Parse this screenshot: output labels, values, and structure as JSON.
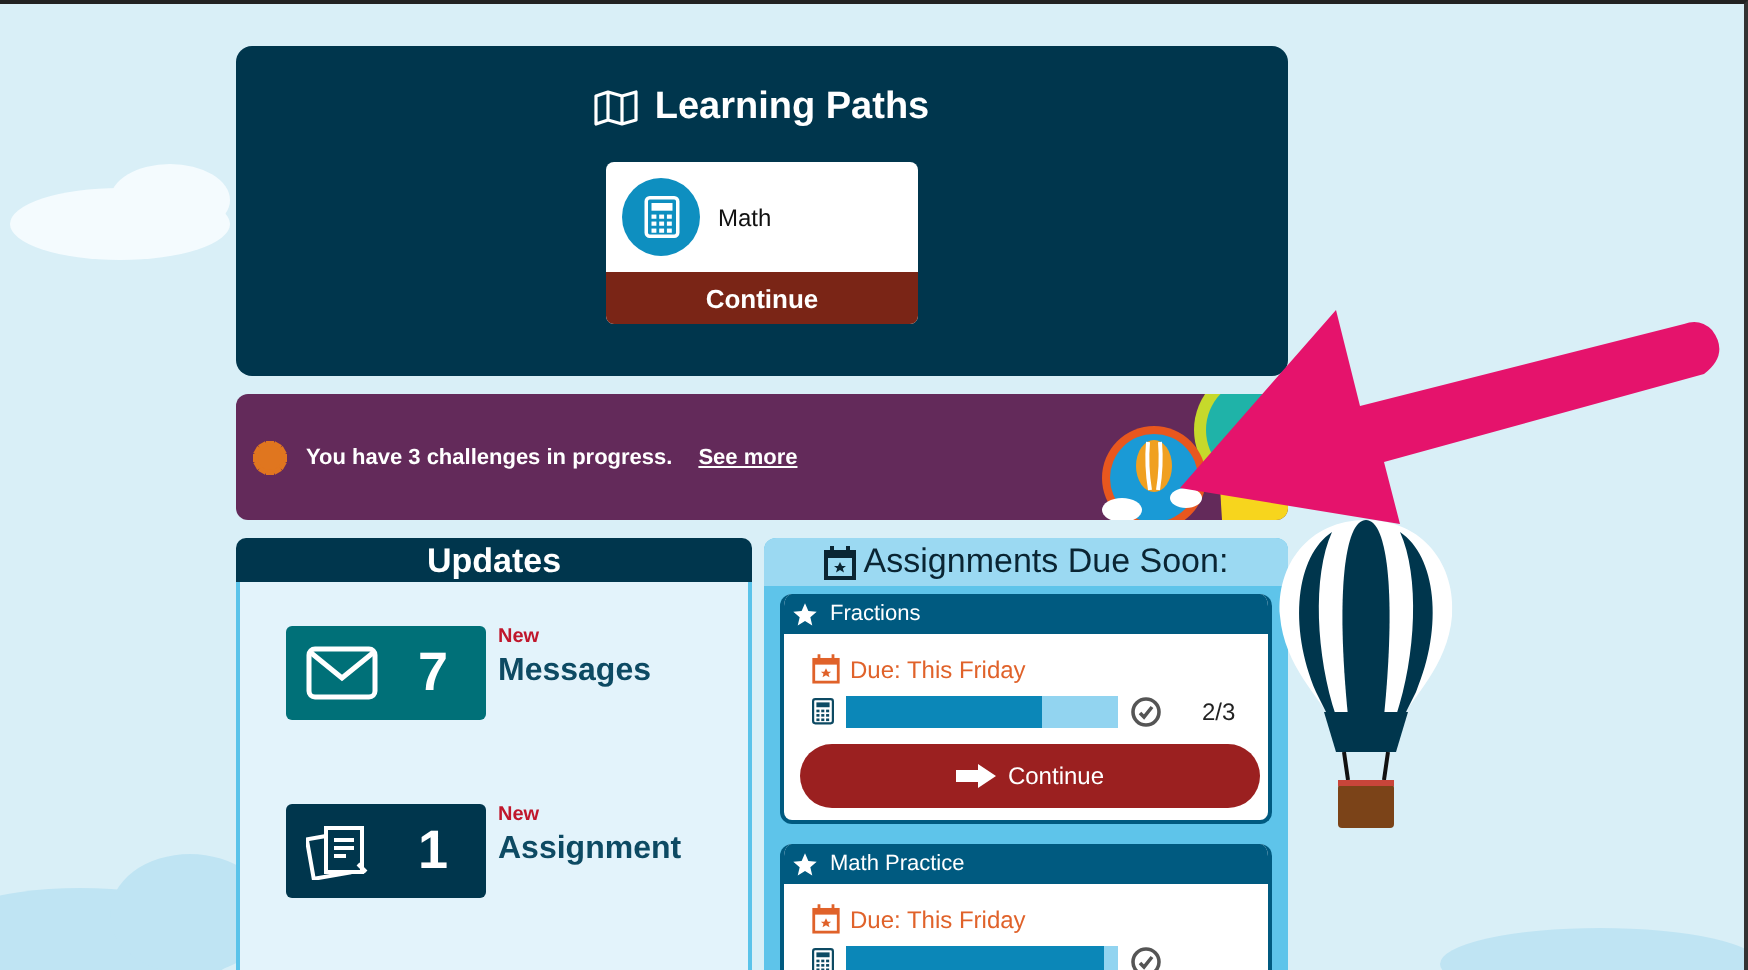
{
  "learning_paths": {
    "title": "Learning Paths",
    "paths": [
      {
        "name": "Math",
        "button": "Continue"
      }
    ]
  },
  "challenges_banner": {
    "text": "You have 3 challenges in progress.",
    "link": "See more"
  },
  "updates": {
    "title": "Updates",
    "items": [
      {
        "kind": "messages",
        "count": "7",
        "badge": "New",
        "label": "Messages"
      },
      {
        "kind": "assignments",
        "count": "1",
        "badge": "New",
        "label": "Assignment"
      }
    ]
  },
  "assignments_due": {
    "title": "Assignments Due Soon:",
    "items": [
      {
        "title": "Fractions",
        "due": "Due: This Friday",
        "level": 0.72,
        "reading": "2/3",
        "button": "Continue"
      },
      {
        "title": "Math Practice",
        "due": "Due: This Friday",
        "level": 0.95
      }
    ]
  }
}
